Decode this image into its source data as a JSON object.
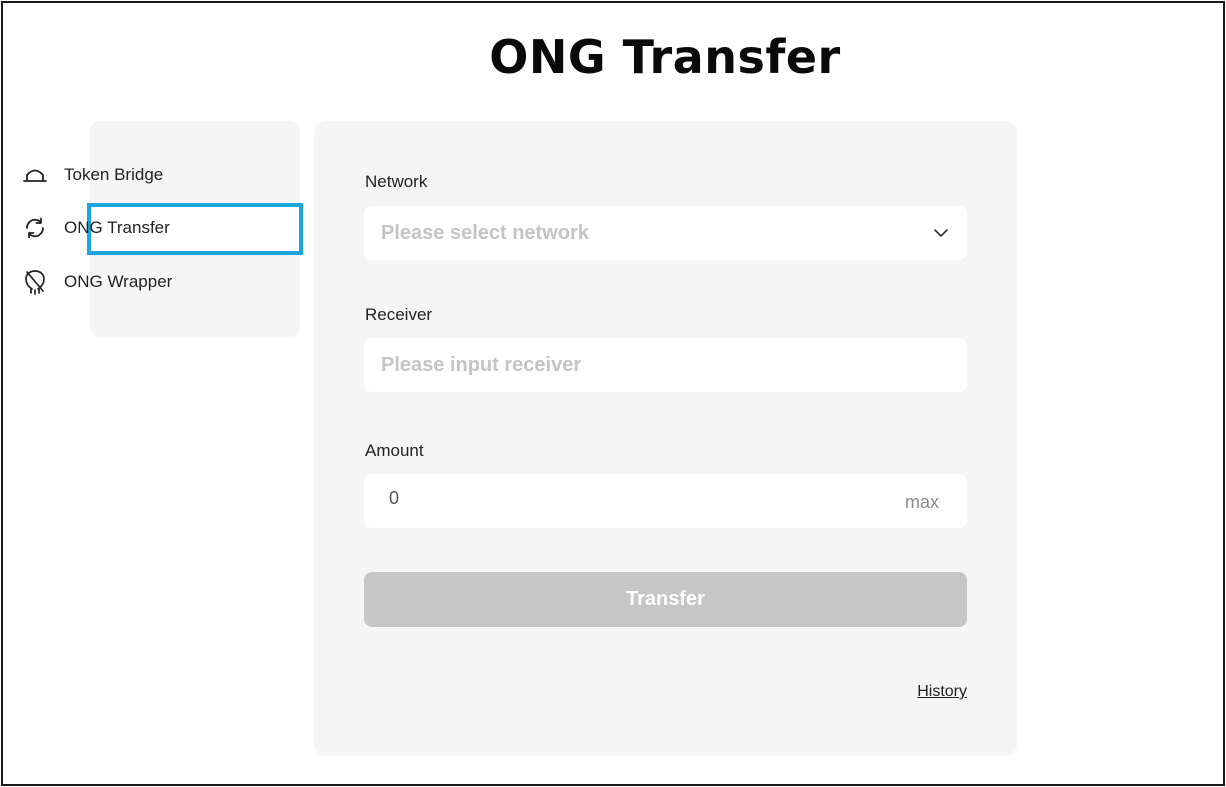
{
  "page": {
    "title": "ONG Transfer"
  },
  "sidebar": {
    "items": [
      {
        "label": "Token Bridge",
        "icon": "bridge-icon",
        "selected": false
      },
      {
        "label": "ONG Transfer",
        "icon": "refresh-icon",
        "selected": true
      },
      {
        "label": "ONG Wrapper",
        "icon": "wrapper-icon",
        "selected": false
      }
    ],
    "selected_outline_color": "#1aa7e0"
  },
  "form": {
    "network": {
      "label": "Network",
      "placeholder": "Please select network",
      "icon": "chevron-down-icon"
    },
    "receiver": {
      "label": "Receiver",
      "placeholder": "Please input receiver"
    },
    "amount": {
      "label": "Amount",
      "value": "0",
      "max_label": "max"
    },
    "transfer_label": "Transfer",
    "history_label": "History"
  },
  "colors": {
    "panel_bg": "#f5f5f5",
    "button_disabled": "#c6c6c6",
    "placeholder": "#c4c4c4"
  }
}
